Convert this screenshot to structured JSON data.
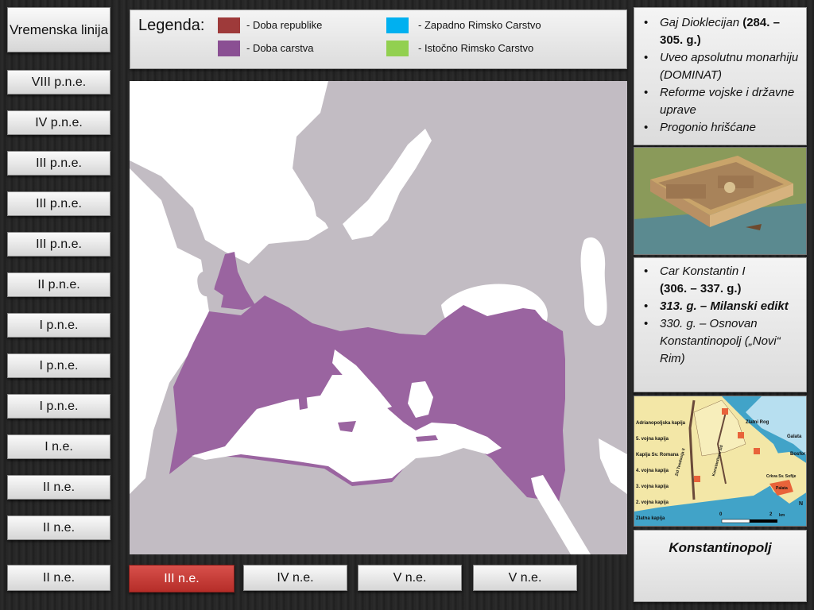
{
  "timeline": {
    "title": "Vremenska linija",
    "items": [
      "VIII p.n.e.",
      "IV p.n.e.",
      "III p.n.e.",
      "III p.n.e.",
      "III p.n.e.",
      "II p.n.e.",
      "I p.n.e.",
      "I p.n.e.",
      "I p.n.e.",
      "I n.e.",
      "II n.e.",
      "II n.e."
    ],
    "bottom_items": [
      "II n.e.",
      "III n.e.",
      "IV n.e.",
      "V n.e.",
      "V n.e."
    ],
    "active_item": "III n.e."
  },
  "legend": {
    "title": "Legenda:",
    "entries": [
      {
        "label": "- Doba republike",
        "color": "#9e3a3a"
      },
      {
        "label": "- Doba carstva",
        "color": "#8a4f93"
      },
      {
        "label": "- Zapadno  Rimsko  Carstvo",
        "color": "#00b0f0"
      },
      {
        "label": "- Istočno  Rimsko  Carstvo",
        "color": "#92d050"
      }
    ]
  },
  "colors": {
    "empire": "#9a64a0",
    "land": "#c2bcc3",
    "sea": "#ffffff",
    "active_button": "#c0312c"
  },
  "info_top": {
    "items": [
      {
        "italic": "Gaj Dioklecijan",
        "bold": "(284. – 305. g.)"
      },
      {
        "italic": "Uveo apsolutnu monarhiju (DOMINAT)"
      },
      {
        "italic": "Reforme vojske i državne uprave"
      },
      {
        "italic": "Progonio hrišćane"
      }
    ]
  },
  "info_bottom": {
    "items": [
      {
        "line1": "Car Konstantin I",
        "line2": "(306. – 337. g.)"
      },
      {
        "bold_italic": "313. g. – Milanski edikt"
      },
      {
        "italic": "330. g. – Osnovan Konstantinopolj („Novi“ Rim)"
      }
    ]
  },
  "constantinople_map": {
    "labels": [
      "Adrianopoljska kapija",
      "5. vojna kapija",
      "Kapija Sv. Romana",
      "4. vojna kapija",
      "3. vojna kapija",
      "2. vojna kapija",
      "Zlatna kapija",
      "Zlatni Rog",
      "Galata",
      "Bosfor",
      "Crkva Sv. Sofije",
      "Palata",
      "Zid Teodosija II",
      "Konstantinov zid"
    ],
    "scale": [
      "0",
      "2",
      "km"
    ],
    "north": "N"
  },
  "caption": "Konstantinopolj"
}
